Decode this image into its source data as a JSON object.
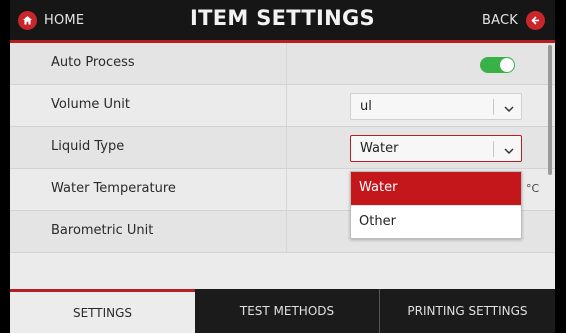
{
  "header": {
    "home_label": "HOME",
    "title": "ITEM SETTINGS",
    "back_label": "BACK"
  },
  "colors": {
    "accent": "#c4171c",
    "toggle_on": "#38b248",
    "header_bg": "#161616"
  },
  "settings": {
    "auto_process": {
      "label": "Auto Process",
      "enabled": true
    },
    "volume_unit": {
      "label": "Volume Unit",
      "value": "ul"
    },
    "liquid_type": {
      "label": "Liquid Type",
      "value": "Water"
    },
    "water_temperature": {
      "label": "Water Temperature",
      "unit": "°C"
    },
    "barometric_unit": {
      "label": "Barometric Unit"
    }
  },
  "dropdown": {
    "options": [
      "Water",
      "Other"
    ],
    "selected": "Water"
  },
  "tabs": [
    {
      "label": "SETTINGS",
      "active": true
    },
    {
      "label": "TEST METHODS",
      "active": false
    },
    {
      "label": "PRINTING SETTINGS",
      "active": false
    }
  ]
}
